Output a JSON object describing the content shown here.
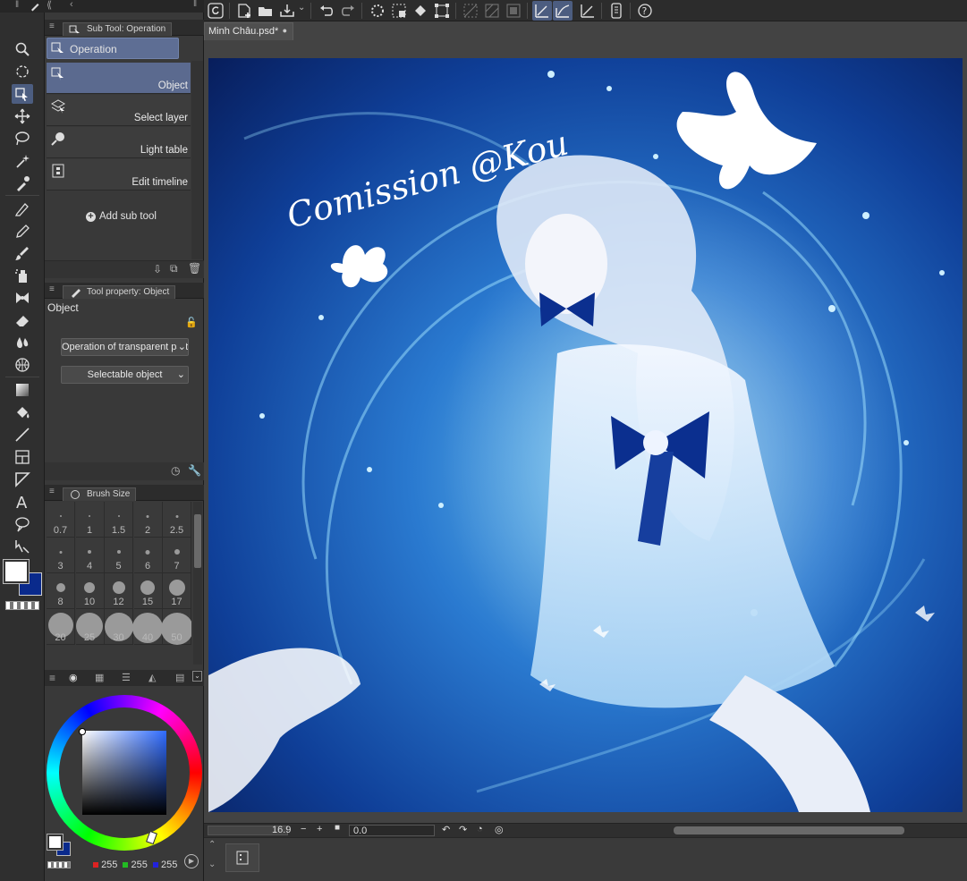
{
  "document": {
    "tab_title": "Minh Châu.psd*"
  },
  "artwork": {
    "signature_text": "Comission @Kou"
  },
  "subtool_panel": {
    "title": "Sub Tool: Operation",
    "group_label": "Operation",
    "items": [
      {
        "label": "Object",
        "selected": true
      },
      {
        "label": "Select layer",
        "selected": false
      },
      {
        "label": "Light table",
        "selected": false
      },
      {
        "label": "Edit timeline",
        "selected": false
      }
    ],
    "add_label": "Add sub tool"
  },
  "tool_property": {
    "title": "Tool property: Object",
    "section_label": "Object",
    "transparent_select": "Operation of transparent part",
    "selectable_select": "Selectable object"
  },
  "brush_size": {
    "title": "Brush Size",
    "sizes": [
      "0.7",
      "1",
      "1.5",
      "2",
      "2.5",
      "3",
      "4",
      "5",
      "6",
      "7",
      "8",
      "10",
      "12",
      "15",
      "17",
      "20",
      "25",
      "30",
      "40",
      "50"
    ]
  },
  "color": {
    "main_color": "#ffffff",
    "sub_color": "#0a2a8c",
    "r": "255",
    "g": "255",
    "b": "255"
  },
  "status": {
    "zoom": "16.9",
    "rotation": "0.0"
  },
  "icons": {
    "top": [
      "app-logo-icon",
      "new-file-icon",
      "open-file-icon",
      "save-icon",
      "undo-icon",
      "redo-icon",
      "loading-icon",
      "clear-icon",
      "fill-icon",
      "transform-icon",
      "grid-icon",
      "ruler-icon",
      "crop-icon",
      "snap-ruler-icon",
      "snap-special-icon",
      "snap-grid-icon",
      "smartphone-icon",
      "help-icon"
    ],
    "tools": [
      "zoom-icon",
      "rotate-view-icon",
      "operation-icon",
      "move-layer-icon",
      "lasso-select-icon",
      "magic-wand-icon",
      "eyedropper-icon",
      "pen-icon",
      "pencil-icon",
      "brush-icon",
      "airbrush-icon",
      "decoration-icon",
      "eraser-icon",
      "blend-icon",
      "mesh-icon",
      "gradient-icon",
      "fill-bucket-icon",
      "line-icon",
      "frame-icon",
      "ruler-tool-icon",
      "text-icon",
      "balloon-icon",
      "correct-line-icon"
    ]
  }
}
